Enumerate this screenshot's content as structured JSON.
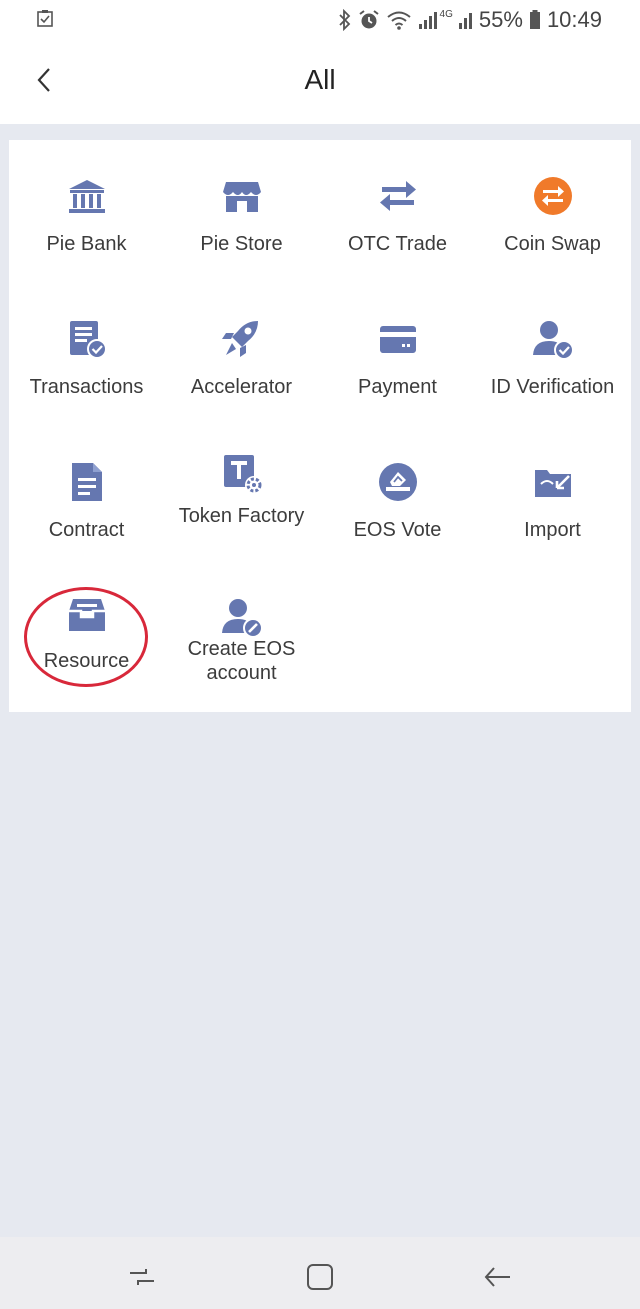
{
  "status": {
    "battery": "55%",
    "time": "10:49",
    "network": "4G"
  },
  "header": {
    "title": "All"
  },
  "apps": [
    {
      "label": "Pie Bank",
      "icon": "bank-icon"
    },
    {
      "label": "Pie Store",
      "icon": "store-icon"
    },
    {
      "label": "OTC Trade",
      "icon": "swap-arrows-icon"
    },
    {
      "label": "Coin Swap",
      "icon": "coin-swap-icon"
    },
    {
      "label": "Transactions",
      "icon": "transactions-icon"
    },
    {
      "label": "Accelerator",
      "icon": "rocket-icon"
    },
    {
      "label": "Payment",
      "icon": "card-icon"
    },
    {
      "label": "ID Verification",
      "icon": "user-check-icon"
    },
    {
      "label": "Contract",
      "icon": "document-icon"
    },
    {
      "label": "Token Factory",
      "icon": "token-factory-icon"
    },
    {
      "label": "EOS Vote",
      "icon": "vote-icon"
    },
    {
      "label": "Import",
      "icon": "import-wallet-icon"
    },
    {
      "label": "Resource",
      "icon": "resource-box-icon"
    },
    {
      "label_line1": "Create EOS",
      "label_line2": "account",
      "icon": "create-account-icon"
    }
  ],
  "colors": {
    "icon": "#6577b0",
    "accent_orange": "#f07a2a",
    "highlight_circle": "#d8283a",
    "background": "#e6e9f0"
  },
  "nav": {
    "recent": "recent-apps-icon",
    "home": "home-icon",
    "back": "back-arrow-icon"
  }
}
